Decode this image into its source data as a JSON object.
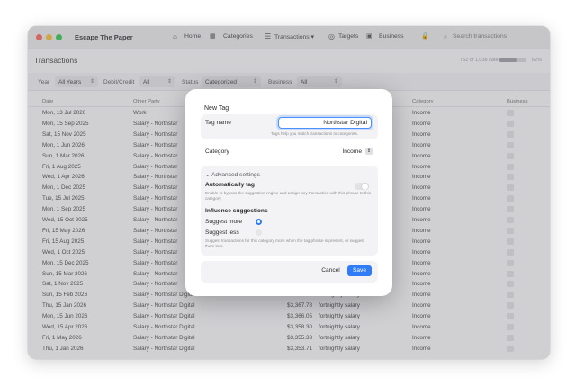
{
  "app": {
    "title": "Escape The Paper",
    "traffic_lights": [
      "#ff5f57",
      "#febc2e",
      "#28c840"
    ],
    "nav": [
      {
        "label": "Home",
        "icon": "home-icon"
      },
      {
        "label": "Categories",
        "icon": "categories-icon"
      },
      {
        "label": "Transactions ▾",
        "icon": "list-icon"
      },
      {
        "label": "Targets",
        "icon": "target-icon"
      },
      {
        "label": "Business",
        "icon": "briefcase-icon"
      }
    ],
    "lock_icon": "lock-icon",
    "search_placeholder": "Search transactions"
  },
  "page": {
    "title": "Transactions",
    "summary": "752 of 1,038 categorised",
    "progress_fraction": 0.62,
    "percent": "62%"
  },
  "filters": {
    "year_label": "Year",
    "year_value": "All Years",
    "debit_label": "Debit/Credit",
    "debit_value": "All",
    "status_label": "Status",
    "status_value": "Categorized",
    "business_label": "Business",
    "business_value": "All"
  },
  "table": {
    "headers": [
      "Date",
      "Other Party",
      "Category",
      "Business"
    ],
    "rows": [
      {
        "date": "Mon, 13 Jul 2026",
        "party": "Work",
        "amount": "",
        "desc": "",
        "category": "Income"
      },
      {
        "date": "Mon, 15 Sep 2025",
        "party": "Salary - Northstar",
        "amount": "",
        "desc": "",
        "category": "Income"
      },
      {
        "date": "Sat, 15 Nov 2025",
        "party": "Salary - Northstar",
        "amount": "",
        "desc": "",
        "category": "Income"
      },
      {
        "date": "Mon, 1 Jun 2026",
        "party": "Salary - Northstar",
        "amount": "",
        "desc": "",
        "category": "Income"
      },
      {
        "date": "Sun, 1 Mar 2026",
        "party": "Salary - Northstar",
        "amount": "",
        "desc": "",
        "category": "Income"
      },
      {
        "date": "Fri, 1 Aug 2025",
        "party": "Salary - Northstar",
        "amount": "",
        "desc": "",
        "category": "Income"
      },
      {
        "date": "Wed, 1 Apr 2026",
        "party": "Salary - Northstar",
        "amount": "",
        "desc": "",
        "category": "Income"
      },
      {
        "date": "Mon, 1 Dec 2025",
        "party": "Salary - Northstar",
        "amount": "",
        "desc": "",
        "category": "Income"
      },
      {
        "date": "Tue, 15 Jul 2025",
        "party": "Salary - Northstar",
        "amount": "",
        "desc": "",
        "category": "Income"
      },
      {
        "date": "Mon, 1 Sep 2025",
        "party": "Salary - Northstar",
        "amount": "",
        "desc": "",
        "category": "Income"
      },
      {
        "date": "Wed, 15 Oct 2025",
        "party": "Salary - Northstar",
        "amount": "",
        "desc": "",
        "category": "Income"
      },
      {
        "date": "Fri, 15 May 2026",
        "party": "Salary - Northstar",
        "amount": "",
        "desc": "",
        "category": "Income"
      },
      {
        "date": "Fri, 15 Aug 2025",
        "party": "Salary - Northstar",
        "amount": "",
        "desc": "",
        "category": "Income"
      },
      {
        "date": "Wed, 1 Oct 2025",
        "party": "Salary - Northstar",
        "amount": "",
        "desc": "",
        "category": "Income"
      },
      {
        "date": "Mon, 15 Dec 2025",
        "party": "Salary - Northstar",
        "amount": "",
        "desc": "",
        "category": "Income"
      },
      {
        "date": "Sun, 15 Mar 2026",
        "party": "Salary - Northstar",
        "amount": "",
        "desc": "",
        "category": "Income"
      },
      {
        "date": "Sat, 1 Nov 2025",
        "party": "Salary - Northstar",
        "amount": "",
        "desc": "",
        "category": "Income"
      },
      {
        "date": "Sun, 15 Feb 2026",
        "party": "Salary - Northstar Digital",
        "amount": "",
        "desc": "fortnightly salary",
        "category": "Income"
      },
      {
        "date": "Thu, 15 Jan 2026",
        "party": "Salary - Northstar Digital",
        "amount": "$3,367.78",
        "desc": "fortnightly salary",
        "category": "Income"
      },
      {
        "date": "Mon, 15 Jun 2026",
        "party": "Salary - Northstar Digital",
        "amount": "$3,366.05",
        "desc": "fortnightly salary",
        "category": "Income"
      },
      {
        "date": "Wed, 15 Apr 2026",
        "party": "Salary - Northstar Digital",
        "amount": "$3,358.30",
        "desc": "fortnightly salary",
        "category": "Income"
      },
      {
        "date": "Fri, 1 May 2026",
        "party": "Salary - Northstar Digital",
        "amount": "$3,355.33",
        "desc": "fortnightly salary",
        "category": "Income"
      },
      {
        "date": "Thu, 1 Jan 2026",
        "party": "Salary - Northstar Digital",
        "amount": "$3,353.71",
        "desc": "fortnightly salary",
        "category": "Income"
      }
    ]
  },
  "modal": {
    "title": "New Tag",
    "tag_name_label": "Tag name",
    "tag_name_value": "Northstar Digital",
    "tag_name_hint": "Tags help you match transactions to categories.",
    "category_label": "Category",
    "category_value": "Income",
    "advanced_header": "Advanced settings",
    "auto_tag_label": "Automatically tag",
    "auto_tag_on": false,
    "auto_tag_hint": "Enable to bypass the suggestion engine and assign any transaction with this phrase to this category.",
    "influence_label": "Influence suggestions",
    "suggest_more_label": "Suggest more",
    "suggest_less_label": "Suggest less",
    "selected_influence": "suggest_more",
    "influence_hint": "Suggest transactions for this category more when the tag phrase is present, or suggest them less.",
    "cancel_label": "Cancel",
    "save_label": "Save",
    "accent": "#2f7cf6"
  }
}
